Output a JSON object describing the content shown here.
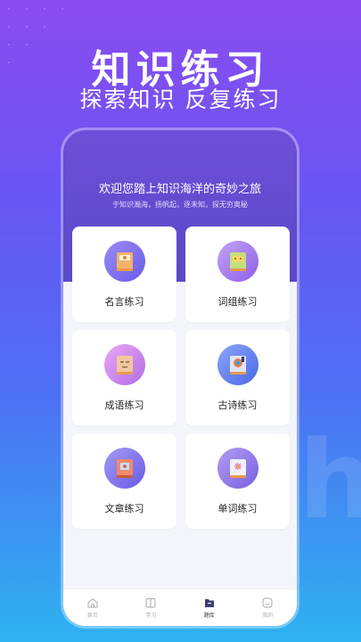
{
  "hero": {
    "title": "知识练习",
    "subtitle": "探索知识 反复练习"
  },
  "screen": {
    "welcome": "欢迎您踏上知识海洋的奇妙之旅",
    "welcome_sub": "于知识瀚海，扬帆起，逐未知，探无穷奥秘"
  },
  "cards": [
    {
      "label": "名言练习",
      "icon": "book-quote-icon",
      "color": "#7b6ef0"
    },
    {
      "label": "词组练习",
      "icon": "book-phrase-icon",
      "color": "#a173ee"
    },
    {
      "label": "成语练习",
      "icon": "book-idiom-icon",
      "color": "#c77be8"
    },
    {
      "label": "古诗练习",
      "icon": "book-poem-icon",
      "color": "#5e7bf0"
    },
    {
      "label": "文章练习",
      "icon": "book-article-icon",
      "color": "#7d72ee"
    },
    {
      "label": "单词练习",
      "icon": "book-word-icon",
      "color": "#8b6fe8"
    }
  ],
  "tabbar": {
    "items": [
      {
        "label": "首页",
        "icon": "home-icon"
      },
      {
        "label": "学习",
        "icon": "study-icon"
      },
      {
        "label": "题库",
        "icon": "question-bank-icon"
      },
      {
        "label": "我的",
        "icon": "profile-icon"
      }
    ]
  },
  "deco_letter": "h"
}
